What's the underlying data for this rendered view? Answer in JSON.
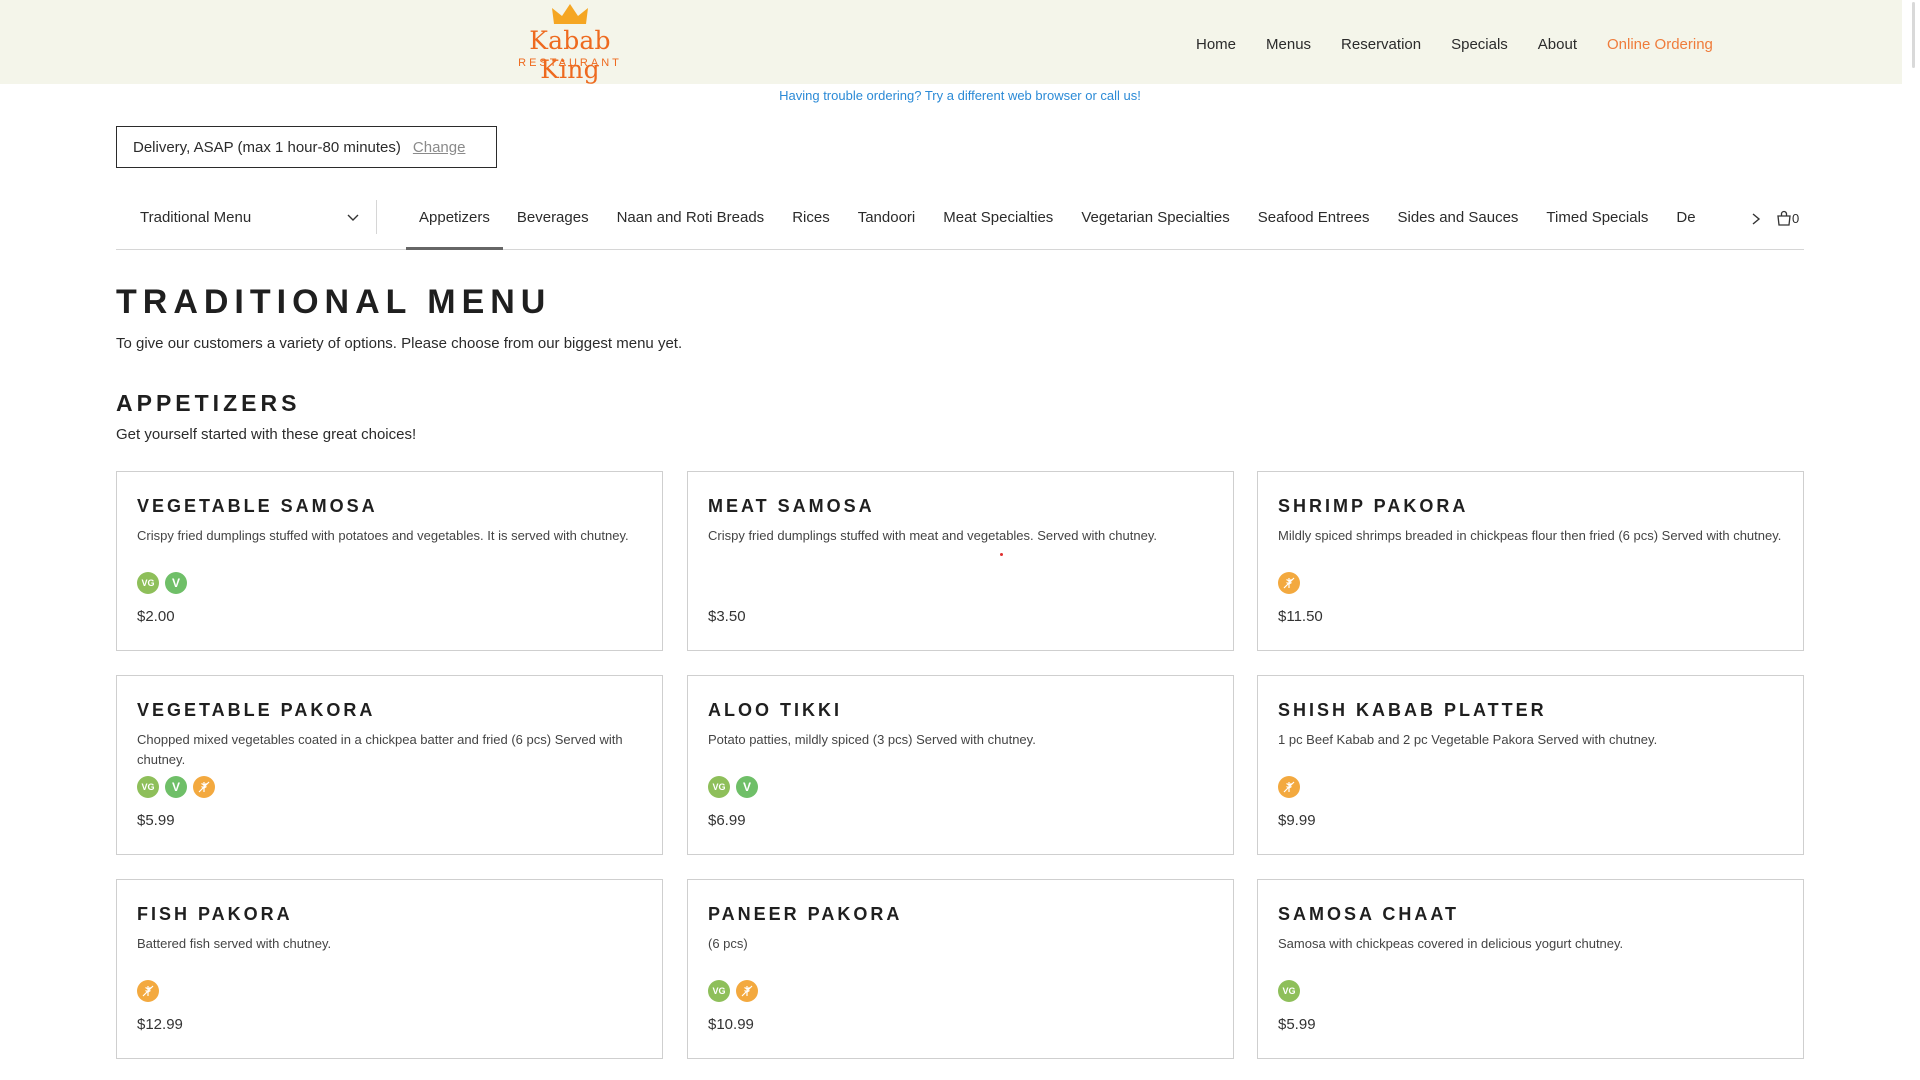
{
  "header": {
    "brand": "Kabab King",
    "brand_sub": "RESTAURANT",
    "nav": [
      "Home",
      "Menus",
      "Reservation",
      "Specials",
      "About",
      "Online Ordering"
    ]
  },
  "notice": "Having trouble ordering?  Try a different web browser or call us!",
  "delivery": {
    "text": "Delivery, ASAP (max 1 hour-80 minutes)",
    "change": "Change"
  },
  "menu_select": "Traditional Menu",
  "tabs": [
    "Appetizers",
    "Beverages",
    "Naan and Roti Breads",
    "Rices",
    "Tandoori",
    "Meat Specialties",
    "Vegetarian Specialties",
    "Seafood Entrees",
    "Sides and Sauces",
    "Timed Specials",
    "De"
  ],
  "cart_count": "0",
  "title": "TRADITIONAL MENU",
  "tagline": "To give our customers a variety of options. Please choose from our biggest menu yet.",
  "section": {
    "title": "APPETIZERS",
    "subtitle": "Get yourself started with these great choices!"
  },
  "badge_labels": {
    "vg": "VG",
    "v": "V"
  },
  "colors": {
    "accent": "#ef7c3b",
    "header_bg": "#f4f5ea",
    "link": "#2b8ad6",
    "vg": "#8ebf5a",
    "v": "#6fbf68",
    "gf": "#f3a93f"
  },
  "items": [
    {
      "name": "VEGETABLE SAMOSA",
      "desc": "Crispy fried dumplings stuffed with potatoes and vegetables. It is served with chutney.",
      "price": "$2.00"
    },
    {
      "name": "MEAT SAMOSA",
      "desc": "Crispy fried dumplings stuffed with meat and vegetables. Served with chutney.",
      "price": "$3.50"
    },
    {
      "name": "SHRIMP PAKORA",
      "desc": "Mildly spiced shrimps breaded in chickpeas flour then fried (6 pcs) Served with chutney.",
      "price": "$11.50"
    },
    {
      "name": "VEGETABLE PAKORA",
      "desc": "Chopped mixed vegetables coated in a chickpea batter and fried (6 pcs) Served with chutney.",
      "price": "$5.99"
    },
    {
      "name": "ALOO TIKKI",
      "desc": "Potato patties, mildly spiced (3 pcs) Served with chutney.",
      "price": "$6.99"
    },
    {
      "name": "SHISH KABAB PLATTER",
      "desc": "1 pc Beef Kabab and 2 pc Vegetable Pakora Served with chutney.",
      "price": "$9.99"
    },
    {
      "name": "FISH PAKORA",
      "desc": "Battered fish served with chutney.",
      "price": "$12.99"
    },
    {
      "name": "PANEER PAKORA",
      "desc": "(6 pcs)",
      "price": "$10.99"
    },
    {
      "name": "SAMOSA CHAAT",
      "desc": "Samosa with chickpeas covered in delicious yogurt chutney.",
      "price": "$5.99"
    }
  ]
}
